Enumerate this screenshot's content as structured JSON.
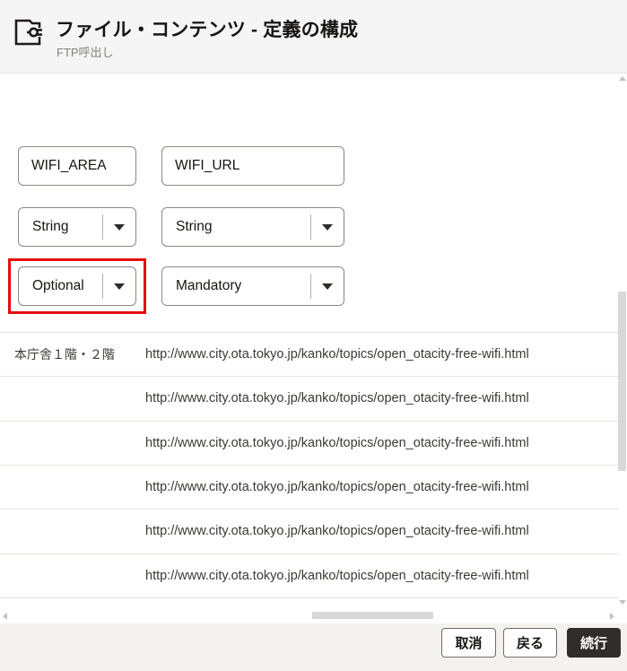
{
  "header": {
    "title": "ファイル・コンテンツ - 定義の構成",
    "subtitle": "FTP呼出し"
  },
  "form": {
    "name_fields": [
      {
        "value": "WIFI_AREA"
      },
      {
        "value": "WIFI_URL"
      }
    ],
    "type_dropdowns": [
      {
        "value": "String"
      },
      {
        "value": "String"
      }
    ],
    "requirement_dropdowns": [
      {
        "value": "Optional",
        "highlighted": true
      },
      {
        "value": "Mandatory",
        "highlighted": false
      }
    ]
  },
  "annotation": {
    "shape": "red-rectangle-highlight",
    "color": "#e60c0c"
  },
  "table": {
    "rows": [
      {
        "area": "本庁舎１階・２階",
        "url": "http://www.city.ota.tokyo.jp/kanko/topics/open_otacity-free-wifi.html"
      },
      {
        "area": "",
        "url": "http://www.city.ota.tokyo.jp/kanko/topics/open_otacity-free-wifi.html"
      },
      {
        "area": "",
        "url": "http://www.city.ota.tokyo.jp/kanko/topics/open_otacity-free-wifi.html"
      },
      {
        "area": "",
        "url": "http://www.city.ota.tokyo.jp/kanko/topics/open_otacity-free-wifi.html"
      },
      {
        "area": "",
        "url": "http://www.city.ota.tokyo.jp/kanko/topics/open_otacity-free-wifi.html"
      },
      {
        "area": "",
        "url": "http://www.city.ota.tokyo.jp/kanko/topics/open_otacity-free-wifi.html"
      }
    ]
  },
  "footer": {
    "buttons": [
      {
        "label": "取消",
        "primary": false
      },
      {
        "label": "戻る",
        "primary": false
      },
      {
        "label": "続行",
        "primary": true
      }
    ]
  },
  "colors": {
    "header_bg": "#f5f5f5",
    "annotation_red": "#e60c0c",
    "primary_button_bg": "#312d2a",
    "footer_bg": "#f4f2ef",
    "row_border": "#e6e3df"
  }
}
